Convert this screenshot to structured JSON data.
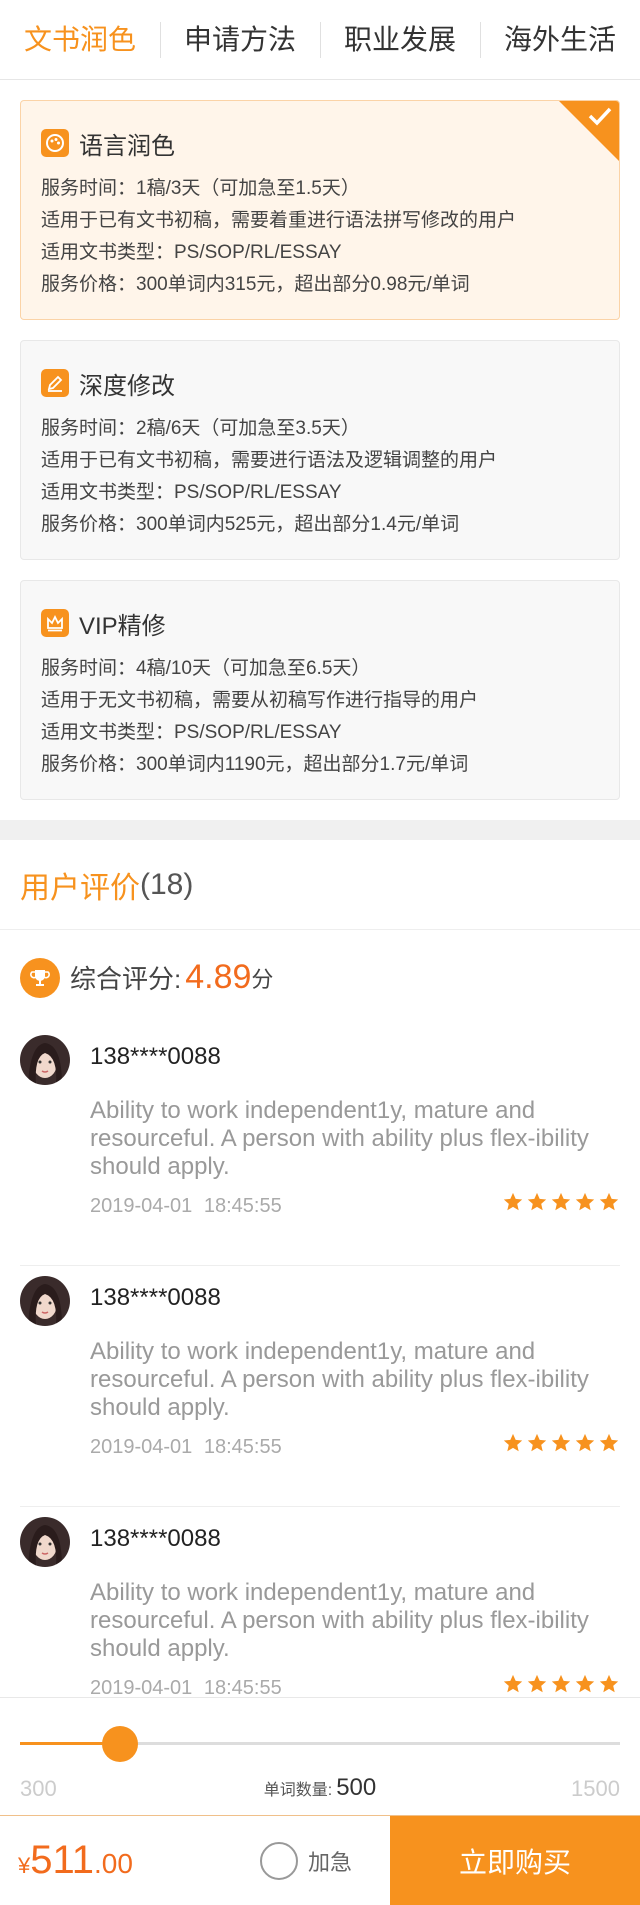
{
  "tabs": [
    {
      "label": "文书润色"
    },
    {
      "label": "申请方法"
    },
    {
      "label": "职业发展"
    },
    {
      "label": "海外生活"
    }
  ],
  "services": [
    {
      "title": "语言润色",
      "icon": "palette-icon",
      "time": "服务时间：1稿/3天（可加急至1.5天）",
      "audience": "适用于已有文书初稿，需要着重进行语法拼写修改的用户",
      "types": "适用文书类型：PS/SOP/RL/ESSAY",
      "price": "服务价格：300单词内315元，超出部分0.98元/单词"
    },
    {
      "title": "深度修改",
      "icon": "edit-icon",
      "time": "服务时间：2稿/6天（可加急至3.5天）",
      "audience": "适用于已有文书初稿，需要进行语法及逻辑调整的用户",
      "types": "适用文书类型：PS/SOP/RL/ESSAY",
      "price": "服务价格：300单词内525元，超出部分1.4元/单词"
    },
    {
      "title": "VIP精修",
      "icon": "crown-icon",
      "time": "服务时间：4稿/10天（可加急至6.5天）",
      "audience": "适用于无文书初稿，需要从初稿写作进行指导的用户",
      "types": "适用文书类型：PS/SOP/RL/ESSAY",
      "price": "服务价格：300单词内1190元，超出部分1.7元/单词"
    }
  ],
  "reviews_header": {
    "title": "用户评价",
    "count": "(18)"
  },
  "overall": {
    "label": "综合评分:",
    "score": "4.89",
    "unit": "分"
  },
  "reviews": [
    {
      "name": "138****0088",
      "text": "Ability to work independent1y, mature and resourceful. A person with ability plus flex-ibility should apply.",
      "date": "2019-04-01 18:45:55",
      "rating": 5
    },
    {
      "name": "138****0088",
      "text": "Ability to work independent1y, mature and resourceful. A person with ability plus flex-ibility should apply.",
      "date": "2019-04-01 18:45:55",
      "rating": 5
    },
    {
      "name": "138****0088",
      "text": "Ability to work independent1y, mature and resourceful. A person with ability plus flex-ibility should apply.",
      "date": "2019-04-01 18:45:55",
      "rating": 5
    }
  ],
  "slider": {
    "min": "300",
    "max": "1500",
    "label": "单词数量:",
    "value": "500",
    "fraction": 0.1667
  },
  "buy": {
    "currency": "¥",
    "price_int": "511",
    "price_dec": ".00",
    "urgent_label": "加急",
    "button_label": "立即购买"
  },
  "colors": {
    "accent": "#f7921e",
    "price": "#f26b1d"
  }
}
